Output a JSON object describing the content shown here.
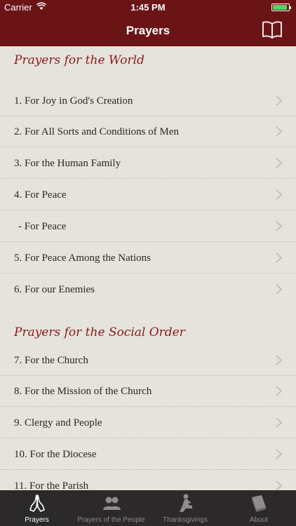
{
  "status_bar": {
    "carrier": "Carrier",
    "time": "1:45 PM"
  },
  "nav": {
    "title": "Prayers",
    "right_icon": "book-icon"
  },
  "sections": [
    {
      "header": "Prayers for the World",
      "items": [
        "1. For Joy in God's Creation",
        "2. For All Sorts and Conditions of Men",
        "3. For the Human Family",
        "4. For Peace",
        " - For Peace",
        "5. For Peace Among the Nations",
        "6. For our Enemies"
      ]
    },
    {
      "header": "Prayers for the Social Order",
      "items": [
        "7. For the Church",
        "8. For the Mission of the Church",
        "9. Clergy and People",
        "10. For the Diocese",
        "11. For the Parish"
      ]
    }
  ],
  "tabs": [
    {
      "label": "Prayers",
      "icon": "praying-hands-icon",
      "active": true
    },
    {
      "label": "Prayers of the People",
      "icon": "people-icon",
      "active": false
    },
    {
      "label": "Thanksgivings",
      "icon": "kneeling-person-icon",
      "active": false
    },
    {
      "label": "About",
      "icon": "books-icon",
      "active": false
    }
  ],
  "colors": {
    "nav_bg": "#6b1416",
    "header_text": "#8a1a1c",
    "tabbar_bg": "#2b2929",
    "battery": "#4cd964"
  }
}
